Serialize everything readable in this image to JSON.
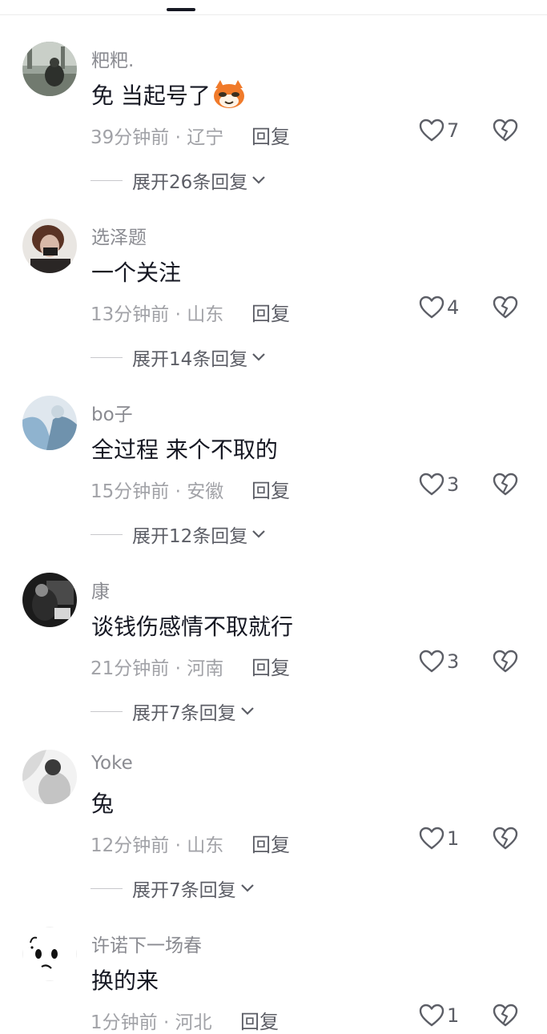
{
  "comments": [
    {
      "username": "粑粑.",
      "text": "免 当起号了",
      "emoji": "fox-emoji",
      "time": "39分钟前",
      "location": "辽宁",
      "reply": "回复",
      "likes": "7",
      "expand": "展开26条回复"
    },
    {
      "username": "选泽题",
      "text": "一个关注",
      "time": "13分钟前",
      "location": "山东",
      "reply": "回复",
      "likes": "4",
      "expand": "展开14条回复"
    },
    {
      "username": "bo子",
      "text": "全过程 来个不取的",
      "time": "15分钟前",
      "location": "安徽",
      "reply": "回复",
      "likes": "3",
      "expand": "展开12条回复"
    },
    {
      "username": "康",
      "text": "谈钱伤感情不取就行",
      "time": "21分钟前",
      "location": "河南",
      "reply": "回复",
      "likes": "3",
      "expand": "展开7条回复"
    },
    {
      "username": "Yoke",
      "text": "兔",
      "time": "12分钟前",
      "location": "山东",
      "reply": "回复",
      "likes": "1",
      "expand": "展开7条回复"
    },
    {
      "username": "许诺下一场春",
      "text": "换的来",
      "time": "1分钟前",
      "location": "河北",
      "reply": "回复",
      "likes": "1"
    }
  ],
  "separator": "·",
  "icons": {
    "like": "heart-outline-icon",
    "dislike": "broken-heart-icon",
    "expand": "chevron-down-icon"
  }
}
